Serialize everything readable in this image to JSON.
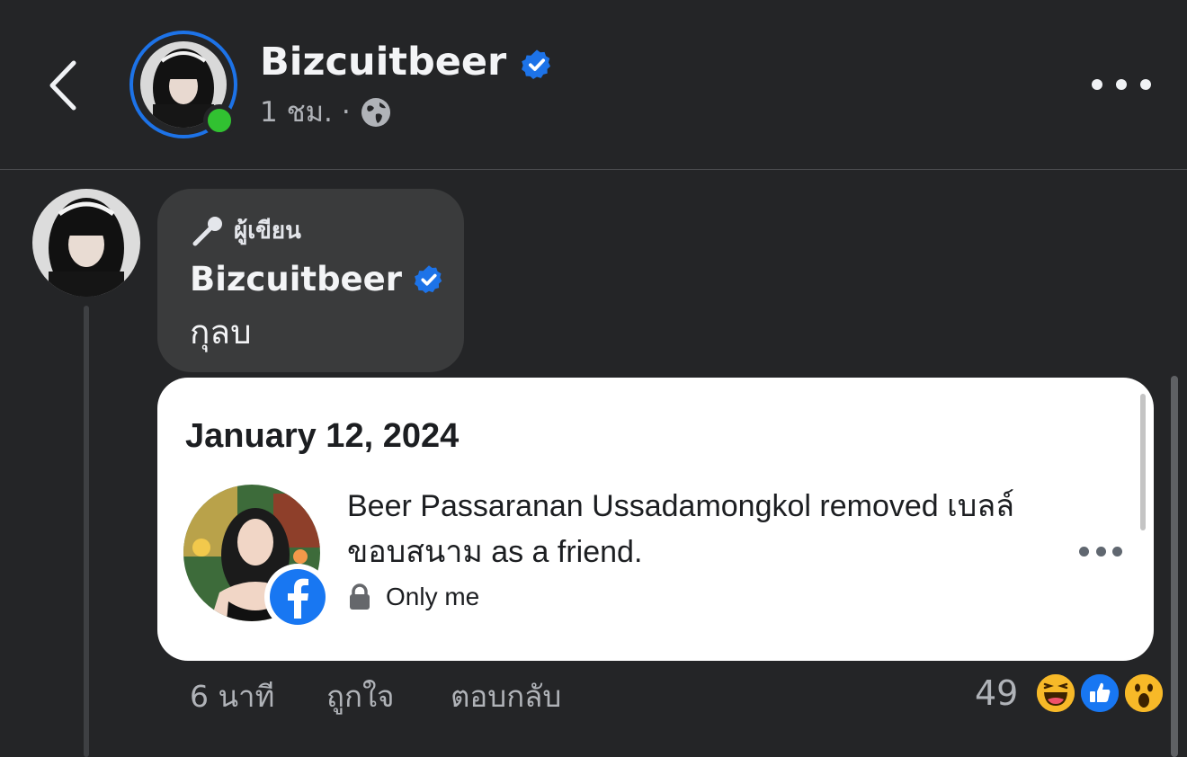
{
  "header": {
    "author_name": "Bizcuitbeer",
    "time": "1 ชม.",
    "separator": "·"
  },
  "comment": {
    "author_badge": "ผู้เขียน",
    "author_name": "Bizcuitbeer",
    "text": "กุลบ",
    "attachment": {
      "date": "January 12, 2024",
      "activity_text": "Beer Passaranan Ussadamongkol removed เบลล์ ขอบสนาม as a friend.",
      "privacy": "Only me"
    },
    "actions": {
      "time": "6 นาที",
      "like": "ถูกใจ",
      "reply": "ตอบกลับ"
    },
    "reaction_count": "49",
    "reaction_icons": [
      "haha-icon",
      "like-icon",
      "wow-icon"
    ]
  },
  "colors": {
    "background": "#242527",
    "bubble": "#3a3b3c",
    "verified_blue": "#1d73e8",
    "online_green": "#31c131",
    "facebook_blue": "#1877f2"
  }
}
